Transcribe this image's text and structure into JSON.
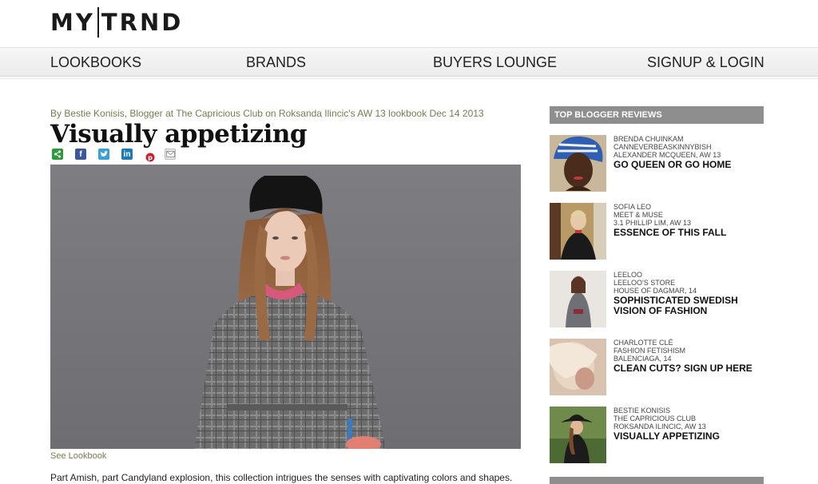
{
  "logo": {
    "left": "MY",
    "right": "TRND"
  },
  "nav": {
    "items": [
      {
        "label": "LOOKBOOKS"
      },
      {
        "label": "BRANDS"
      },
      {
        "label": "BUYERS LOUNGE"
      },
      {
        "label": "SIGNUP & LOGIN"
      }
    ]
  },
  "article": {
    "byline": "By Bestie Konisis, Blogger at The Capricious Club on Roksanda Ilincic's AW 13 lookbook Dec 14 2013",
    "title": "Visually appetizing",
    "share_icons": [
      "share-icon",
      "facebook-icon",
      "twitter-icon",
      "linkedin-icon",
      "pinterest-icon",
      "email-icon"
    ],
    "see_lookbook": "See Lookbook",
    "body": "Part Amish, part Candyland explosion, this collection intrigues the senses with captivating colors and shapes."
  },
  "sidebar": {
    "heading": "TOP BLOGGER REVIEWS",
    "reviews": [
      {
        "name": "BRENDA CHUINKAM",
        "blog": "CANNEVERBEASKINNYBISH",
        "collection": "ALEXANDER MCQUEEN, AW 13",
        "title": "GO QUEEN OR GO HOME"
      },
      {
        "name": "SOFIA LEO",
        "blog": "MEET & MUSE",
        "collection": "3.1 PHILLIP LIM, AW 13",
        "title": "ESSENCE OF THIS FALL"
      },
      {
        "name": "LEELOO",
        "blog": "LEELOO'S STORE",
        "collection": "HOUSE OF DAGMAR, 14",
        "title": "SOPHISTICATED SWEDISH VISION OF FASHION"
      },
      {
        "name": "CHARLOTTE CLÉ",
        "blog": "FASHION FETISHISM",
        "collection": "BALENCIAGA, 14",
        "title": "CLEAN CUTS? SIGN UP HERE"
      },
      {
        "name": "BESTIE KONISIS",
        "blog": "THE CAPRICIOUS CLUB",
        "collection": "ROKSANDA ILINCIC, AW 13",
        "title": "VISUALLY APPETIZING"
      }
    ]
  }
}
